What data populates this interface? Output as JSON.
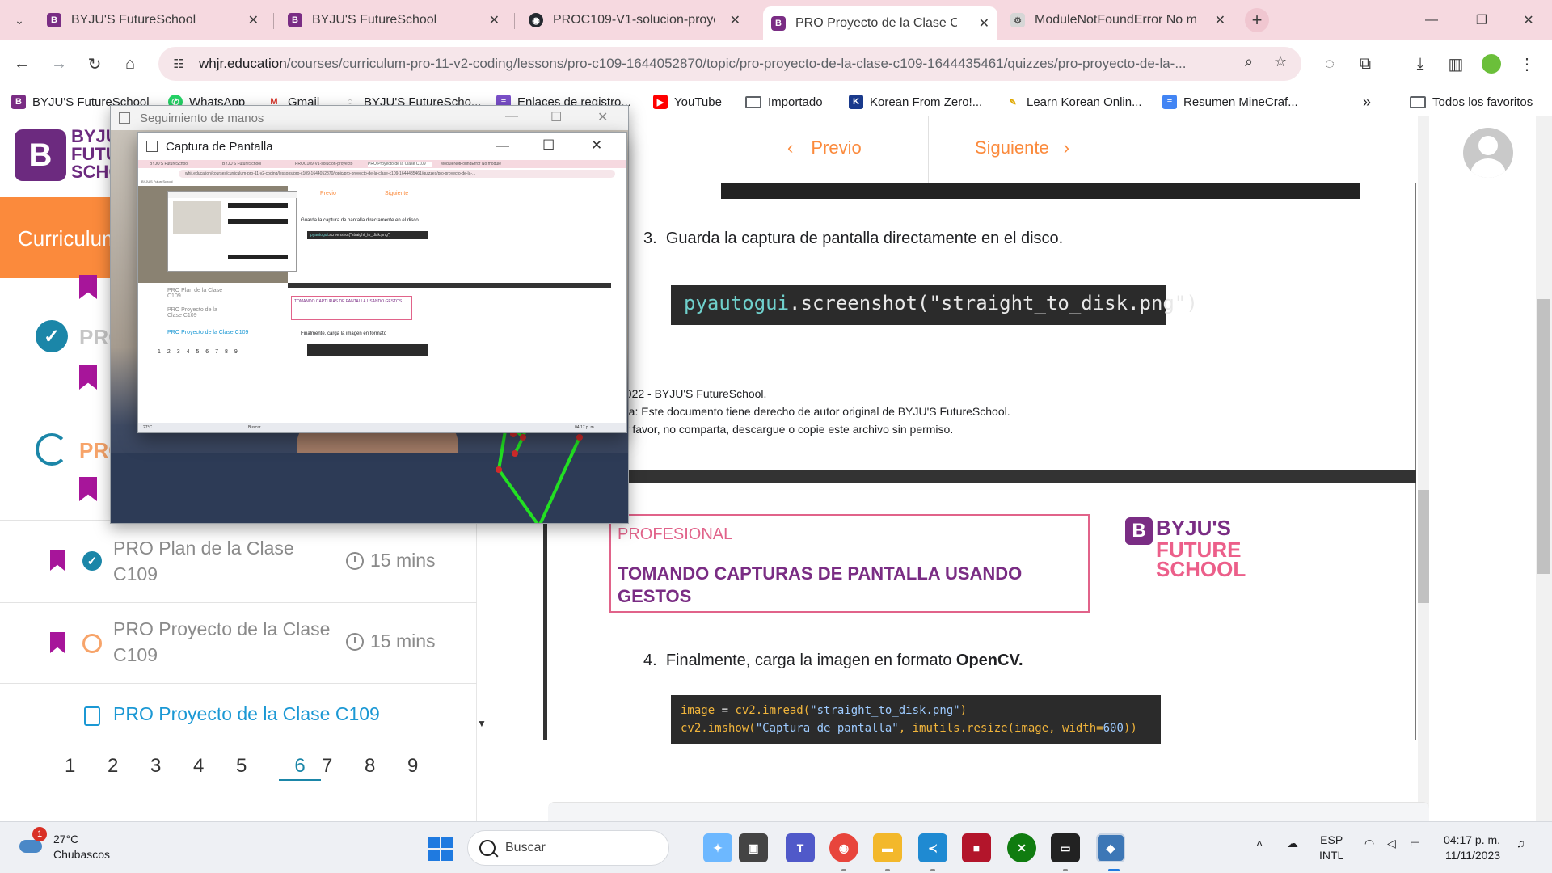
{
  "browser": {
    "tabs": [
      {
        "title": "BYJU'S FutureSchool",
        "active": false
      },
      {
        "title": "BYJU'S FutureSchool",
        "active": false
      },
      {
        "title": "PROC109-V1-solucion-proyecto",
        "active": false
      },
      {
        "title": "PRO Proyecto de la Clase C109",
        "active": true
      },
      {
        "title": "ModuleNotFoundError No module",
        "active": false
      }
    ],
    "url_domain": "whjr.education",
    "url_path": "/courses/curriculum-pro-11-v2-coding/lessons/pro-c109-1644052870/topic/pro-proyecto-de-la-clase-c109-1644435461/quizzes/pro-proyecto-de-la-...",
    "bookmarks": [
      "BYJU'S FutureSchool",
      "WhatsApp",
      "Gmail",
      "BYJU'S FutureScho...",
      "Enlaces de registro...",
      "YouTube",
      "Importado",
      "Korean From Zero!...",
      "Learn Korean Onlin...",
      "Resumen MineCraf..."
    ],
    "all_bookmarks": "Todos los favoritos",
    "overflow": "»"
  },
  "left_panel": {
    "brand_lines": [
      "BYJU'S",
      "FUTURE",
      "SCHOOL"
    ],
    "curriculum_label": "Curriculum",
    "section_heads": [
      "PRO",
      "PRO"
    ],
    "lessons": [
      {
        "title": "PRO Plan de la Clase C109",
        "time": "15 mins",
        "status": "done"
      },
      {
        "title": "PRO Proyecto de la Clase C109",
        "time": "15 mins",
        "status": "in-progress"
      }
    ],
    "current_item": "PRO Proyecto de la Clase C109",
    "pages": [
      "1",
      "2",
      "3",
      "4",
      "5",
      "6",
      "7",
      "8",
      "9"
    ],
    "active_page": "6"
  },
  "nav": {
    "prev_label": "Previo",
    "next_label": "Siguiente"
  },
  "content": {
    "step3_num": "3.",
    "step3_text": "Guarda la captura de pantalla directamente en el disco.",
    "code1": {
      "obj": "pyautogui",
      "rest": ".screenshot(\"straight_to_disk.png\")"
    },
    "footer_lines": [
      "2022 - BYJU'S FutureSchool.",
      "ota: Este documento tiene derecho de autor original de BYJU'S FutureSchool.",
      "or favor, no comparta, descargue o copie este archivo sin permiso."
    ],
    "pro_label": "PROFESIONAL",
    "pro_title": "TOMANDO CAPTURAS DE PANTALLA USANDO GESTOS",
    "logo_lines": [
      "BYJU'S",
      "FUTURE",
      "SCHOOL"
    ],
    "step4_num": "4.",
    "step4_text": "Finalmente, carga la imagen en formato ",
    "step4_bold": "OpenCV.",
    "code2_line1": {
      "var": "image",
      "eq": " = ",
      "call": "cv2.imread(",
      "str": "\"straight_to_disk.png\"",
      "end": ")"
    },
    "code2_line2": {
      "call": "cv2.imshow(",
      "str": "\"Captura de pantalla\"",
      "mid": ", imutils.resize(image, width=",
      "num": "600",
      "end": "))"
    }
  },
  "windows": {
    "tracking_title": "Seguimiento de manos",
    "capture_title": "Captura de Pantalla"
  },
  "taskbar": {
    "weather_temp": "27°C",
    "weather_desc": "Chubascos",
    "weather_badge": "1",
    "search_label": "Buscar",
    "lang_line1": "ESP",
    "lang_line2": "INTL",
    "time": "04:17 p. m.",
    "date": "11/11/2023"
  },
  "colors": {
    "tab_bar": "#f6d9e0",
    "orange": "#fb8a3c",
    "teal": "#1b86a8",
    "purple": "#7a2d84",
    "pink": "#e1638a"
  }
}
